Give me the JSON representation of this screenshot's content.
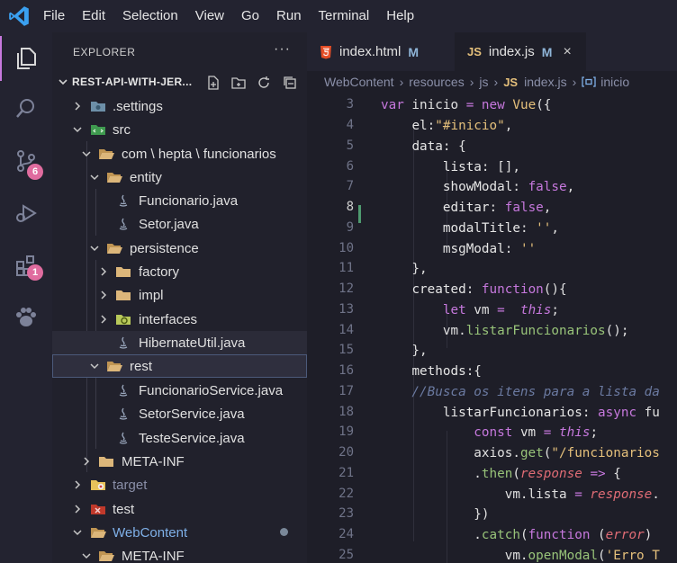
{
  "menu": [
    "File",
    "Edit",
    "Selection",
    "View",
    "Go",
    "Run",
    "Terminal",
    "Help"
  ],
  "activity_badges": {
    "source_control": "6",
    "extensions": "1"
  },
  "explorer": {
    "title": "EXPLORER",
    "more": "···",
    "project": "REST-API-WITH-JER..."
  },
  "tree": [
    {
      "label": ".settings"
    },
    {
      "label": "src"
    },
    {
      "label": "com \\ hepta \\ funcionarios"
    },
    {
      "label": "entity"
    },
    {
      "label": "Funcionario.java"
    },
    {
      "label": "Setor.java"
    },
    {
      "label": "persistence"
    },
    {
      "label": "factory"
    },
    {
      "label": "impl"
    },
    {
      "label": "interfaces"
    },
    {
      "label": "HibernateUtil.java"
    },
    {
      "label": "rest"
    },
    {
      "label": "FuncionarioService.java"
    },
    {
      "label": "SetorService.java"
    },
    {
      "label": "TesteService.java"
    },
    {
      "label": "META-INF"
    },
    {
      "label": "target"
    },
    {
      "label": "test"
    },
    {
      "label": "WebContent"
    },
    {
      "label": "META-INF"
    }
  ],
  "tabs": [
    {
      "label": "index.html",
      "mark": "M",
      "icon": "html5-icon"
    },
    {
      "label": "index.js",
      "mark": "M",
      "icon": "js-icon",
      "badge": "JS"
    }
  ],
  "breadcrumb": {
    "parts": [
      "WebContent",
      "resources",
      "js",
      "index.js",
      "inicio"
    ],
    "js_badge": "JS"
  },
  "line_numbers": [
    "3",
    "4",
    "5",
    "6",
    "7",
    "8",
    "9",
    "10",
    "11",
    "12",
    "13",
    "14",
    "15",
    "16",
    "17",
    "18",
    "19",
    "20",
    "21",
    "22",
    "23",
    "24",
    "25"
  ],
  "code": [
    "var inicio = new Vue({",
    "    el:\"#inicio\",",
    "    data: {",
    "        lista: [],",
    "        showModal: false,",
    "        editar: false,",
    "        modalTitle: '',",
    "        msgModal: ''",
    "    },",
    "    created: function(){",
    "        let vm =  this;",
    "        vm.listarFuncionarios();",
    "    },",
    "    methods:{",
    "    //Busca os itens para a lista da",
    "        listarFuncionarios: async fu",
    "            const vm = this;",
    "            axios.get(\"/funcionarios",
    "            .then(response => {",
    "                vm.lista = response.",
    "            })",
    "            .catch(function (error)",
    "                vm.openModal('Erro T"
  ]
}
